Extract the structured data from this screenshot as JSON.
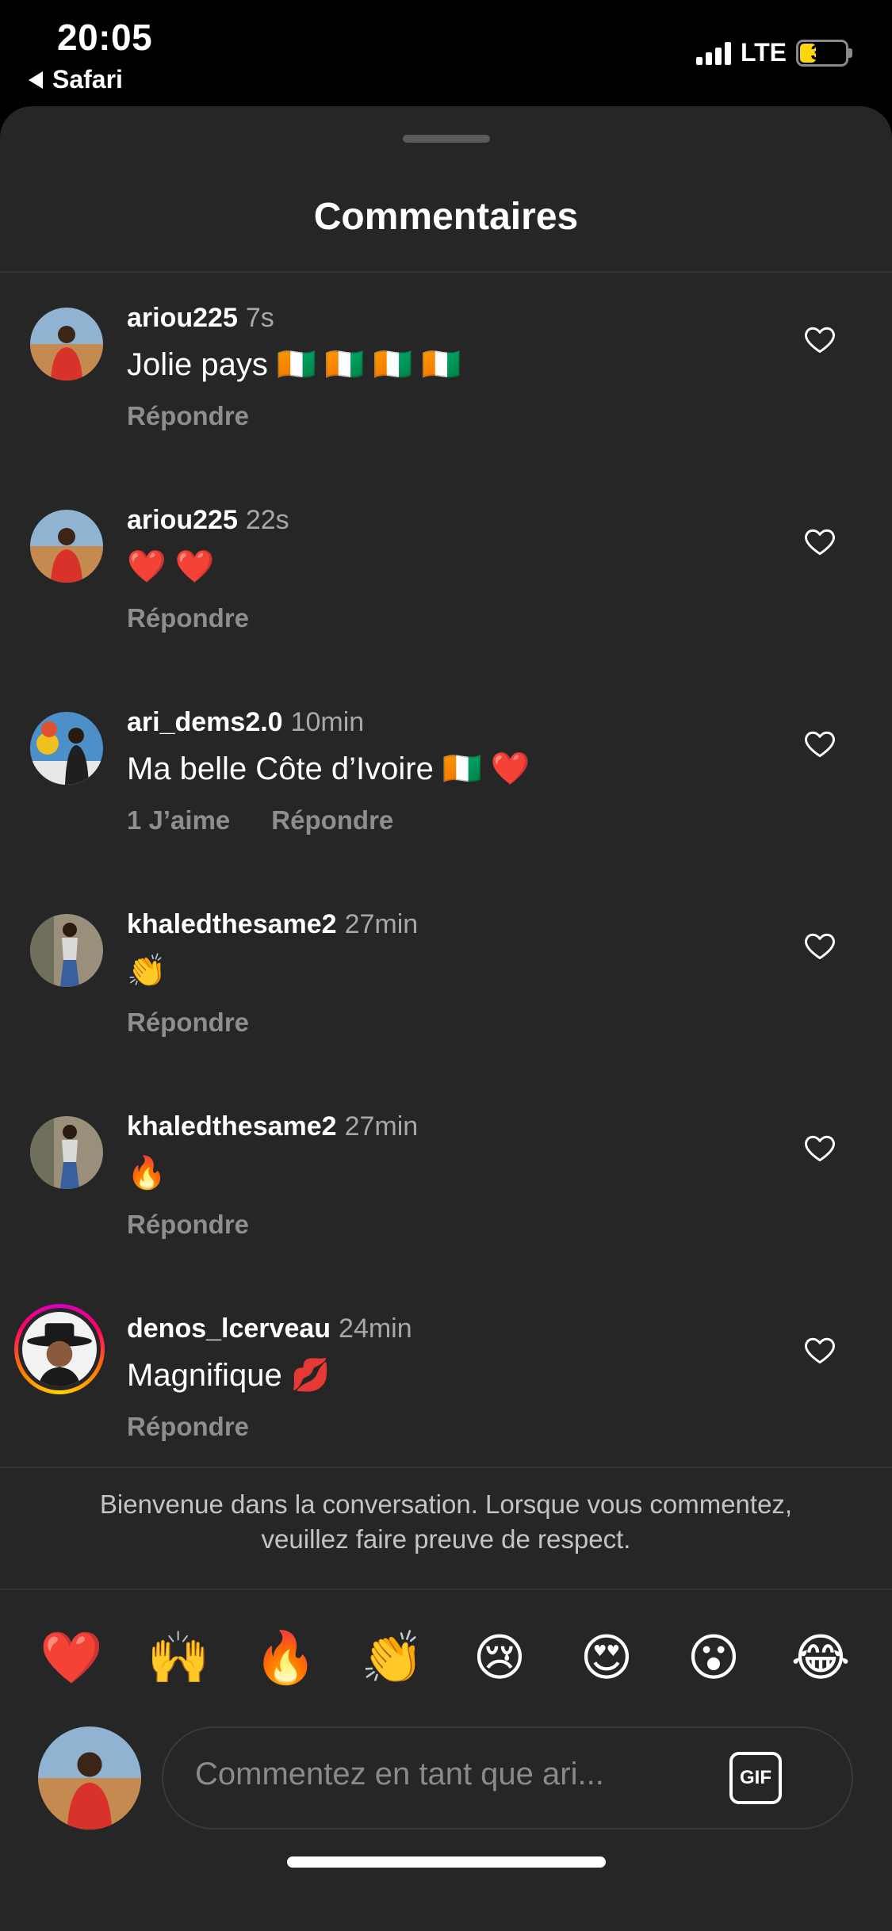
{
  "status_bar": {
    "time": "20:05",
    "back_app": "Safari",
    "network": "LTE",
    "battery": "35",
    "battery_level": 0.35
  },
  "sheet": {
    "title": "Commentaires"
  },
  "comments": [
    {
      "username": "ariou225",
      "time": "7s",
      "text": "Jolie pays 🇨🇮 🇨🇮 🇨🇮 🇨🇮",
      "likes_label": "",
      "reply_label": "Répondre"
    },
    {
      "username": "ariou225",
      "time": "22s",
      "text": "❤️ ❤️",
      "likes_label": "",
      "reply_label": "Répondre"
    },
    {
      "username": "ari_dems2.0",
      "time": "10min",
      "text": "Ma belle Côte d’Ivoire 🇨🇮 ❤️",
      "likes_label": "1 J’aime",
      "reply_label": "Répondre"
    },
    {
      "username": "khaledthesame2",
      "time": "27min",
      "text": "👏",
      "likes_label": "",
      "reply_label": "Répondre"
    },
    {
      "username": "khaledthesame2",
      "time": "27min",
      "text": "🔥",
      "likes_label": "",
      "reply_label": "Répondre"
    },
    {
      "username": "denos_lcerveau",
      "time": "24min",
      "text": "Magnifique 💋",
      "likes_label": "",
      "reply_label": "Répondre"
    }
  ],
  "notice": "Bienvenue dans la conversation. Lorsque vous commentez, veuillez faire preuve de respect.",
  "quick_reactions": [
    "❤️",
    "🙌",
    "🔥",
    "👏",
    "😢",
    "😍",
    "😮",
    "😂"
  ],
  "composer": {
    "placeholder": "Commentez en tant que ari...",
    "gif_label": "GIF"
  },
  "icons": {
    "like": "heart-outline-icon",
    "back": "back-triangle-icon",
    "gif": "gif-icon"
  },
  "colors": {
    "sheet_bg": "#262626",
    "muted_text": "#8e8e8e",
    "battery_accent": "#ffd60a"
  }
}
